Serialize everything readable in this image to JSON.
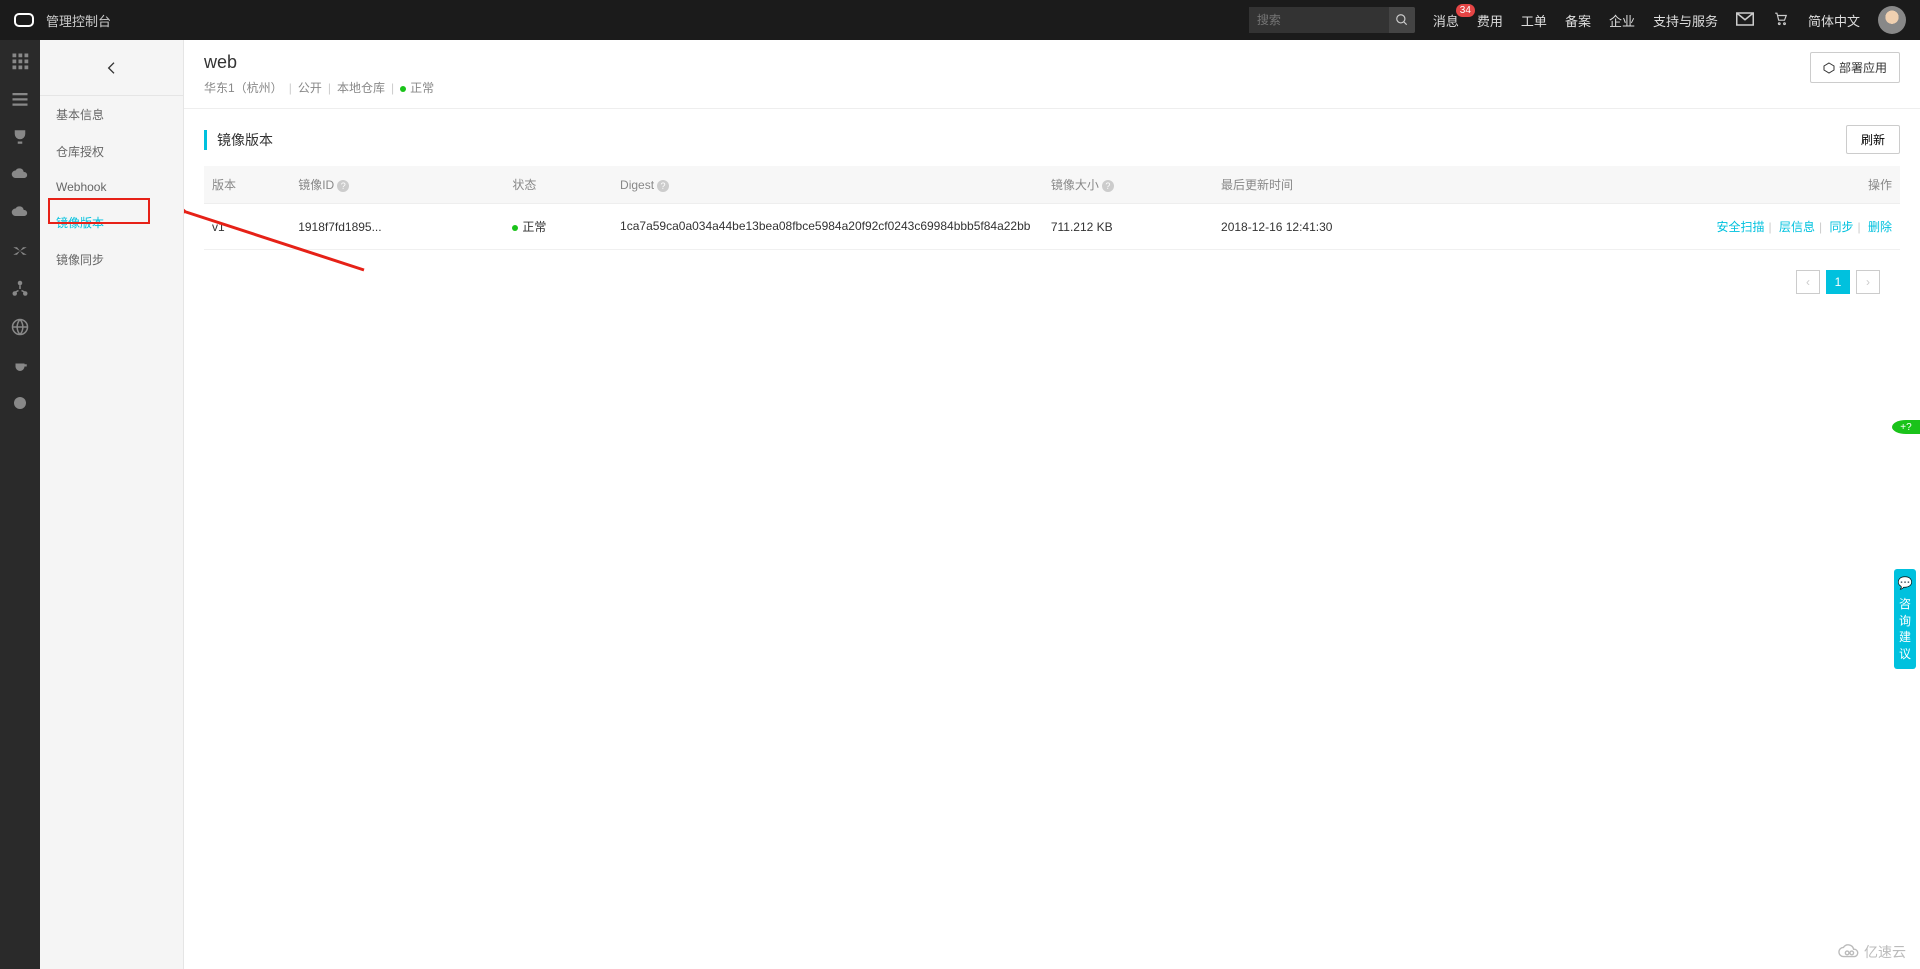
{
  "topbar": {
    "console_label": "管理控制台",
    "search_placeholder": "搜索",
    "nav": {
      "messages": "消息",
      "messages_badge": "34",
      "billing": "费用",
      "tickets": "工单",
      "icp": "备案",
      "enterprise": "企业",
      "support": "支持与服务",
      "lang": "简体中文"
    }
  },
  "sidebar": {
    "items": [
      {
        "label": "基本信息"
      },
      {
        "label": "仓库授权"
      },
      {
        "label": "Webhook"
      },
      {
        "label": "镜像版本"
      },
      {
        "label": "镜像同步"
      }
    ]
  },
  "header": {
    "title": "web",
    "region": "华东1（杭州）",
    "visibility": "公开",
    "repo_type": "本地仓库",
    "status": "正常",
    "deploy_label": "部署应用"
  },
  "section": {
    "title": "镜像版本",
    "refresh": "刷新"
  },
  "table": {
    "headers": {
      "version": "版本",
      "image_id": "镜像ID",
      "status": "状态",
      "digest": "Digest",
      "size": "镜像大小",
      "updated": "最后更新时间",
      "actions": "操作"
    },
    "row": {
      "version": "v1",
      "image_id": "1918f7fd1895...",
      "status": "正常",
      "digest": "1ca7a59ca0a034a44be13bea08fbce5984a20f92cf0243c69984bbb5f84a22bb",
      "size": "711.212 KB",
      "updated": "2018-12-16 12:41:30",
      "actions": {
        "scan": "安全扫描",
        "layers": "层信息",
        "sync": "同步",
        "delete": "删除"
      }
    }
  },
  "pagination": {
    "current": "1"
  },
  "float": {
    "consult": "咨询",
    "suggest": "建议",
    "help": "+?"
  },
  "watermark": "亿速云"
}
